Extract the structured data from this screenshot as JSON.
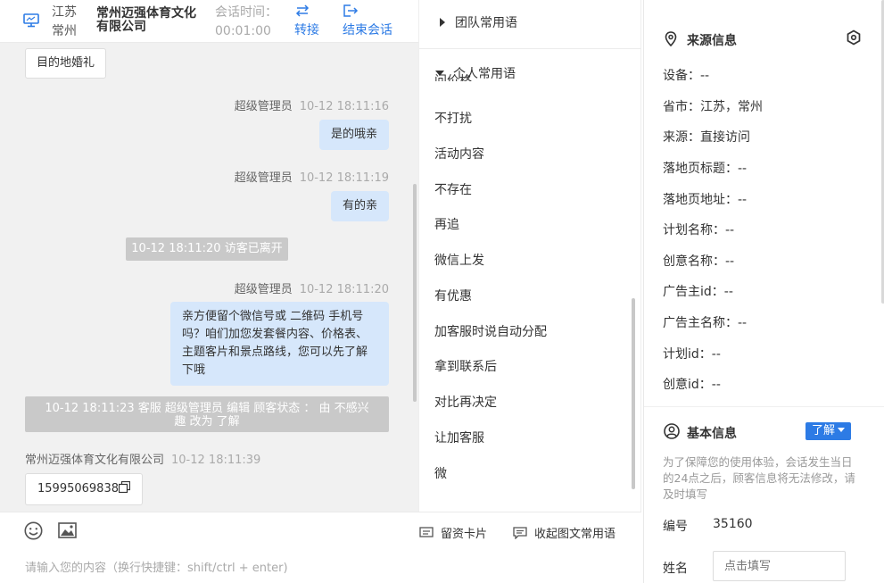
{
  "header": {
    "region_line1": "江苏",
    "region_line2": "常州",
    "company_name": "常州迈强体育文化有限公司",
    "session_time_label": "会话时间：",
    "session_time_value": "00:01:00",
    "transfer_label": "转接",
    "end_session_label": "结束会话"
  },
  "messages": {
    "top_chip": "目的地婚礼",
    "m1_sender": "超级管理员",
    "m1_time": "10-12 18:11:16",
    "m1_text": "是的哦亲",
    "m2_sender": "超级管理员",
    "m2_time": "10-12 18:11:19",
    "m2_text": "有的亲",
    "sys1": "10-12 18:11:20 访客已离开",
    "m3_sender": "超级管理员",
    "m3_time": "10-12 18:11:20",
    "m3_text": "亲方便留个微信号或 二维码 手机号吗？咱们加您发套餐内容、价格表、主题客片和景点路线，您可以先了解下哦",
    "sys2": "10-12 18:11:23 客服 超级管理员 编辑 顾客状态 ： 由 不感兴趣 改为 了解",
    "m4_sender": "常州迈强体育文化有限公司",
    "m4_time": "10-12 18:11:39",
    "m4_text": "15995069838"
  },
  "composer": {
    "placeholder": "请输入您的内容（换行快捷键：shift/ctrl + enter)",
    "lead_card_label": "留资卡片",
    "collapse_label": "收起图文常用语"
  },
  "phrases": {
    "team_label": "团队常用语",
    "personal_label": "个人常用语",
    "clipped_item": "问价格",
    "items": [
      "不打扰",
      "活动内容",
      "不存在",
      "再追",
      "微信上发",
      "有优惠",
      "加客服时说自动分配",
      "拿到联系后",
      "对比再决定",
      "让加客服",
      "微"
    ]
  },
  "source_info": {
    "title": "来源信息",
    "device": "设备：--",
    "province_city": "省市：江苏，常州",
    "source": "来源：直接访问",
    "landing_title": "落地页标题：--",
    "landing_url": "落地页地址：--",
    "plan_name": "计划名称：--",
    "creative_name": "创意名称：--",
    "advertiser_id": "广告主id：--",
    "advertiser_name": "广告主名称：--",
    "plan_id": "计划id：--",
    "creative_id": "创意id：--"
  },
  "basic_info": {
    "title": "基本信息",
    "status_badge": "了解",
    "notice": "为了保障您的使用体验，会话发生当日的24点之后，顾客信息将无法修改，请及时填写",
    "id_label": "编号",
    "id_value": "35160",
    "name_label": "姓名",
    "name_placeholder": "点击填写"
  },
  "colors": {
    "accent": "#2d7be5",
    "bubble": "#d6e7fb",
    "system_bar": "#c9c9c9",
    "chat_bg": "#f1f1f1"
  }
}
